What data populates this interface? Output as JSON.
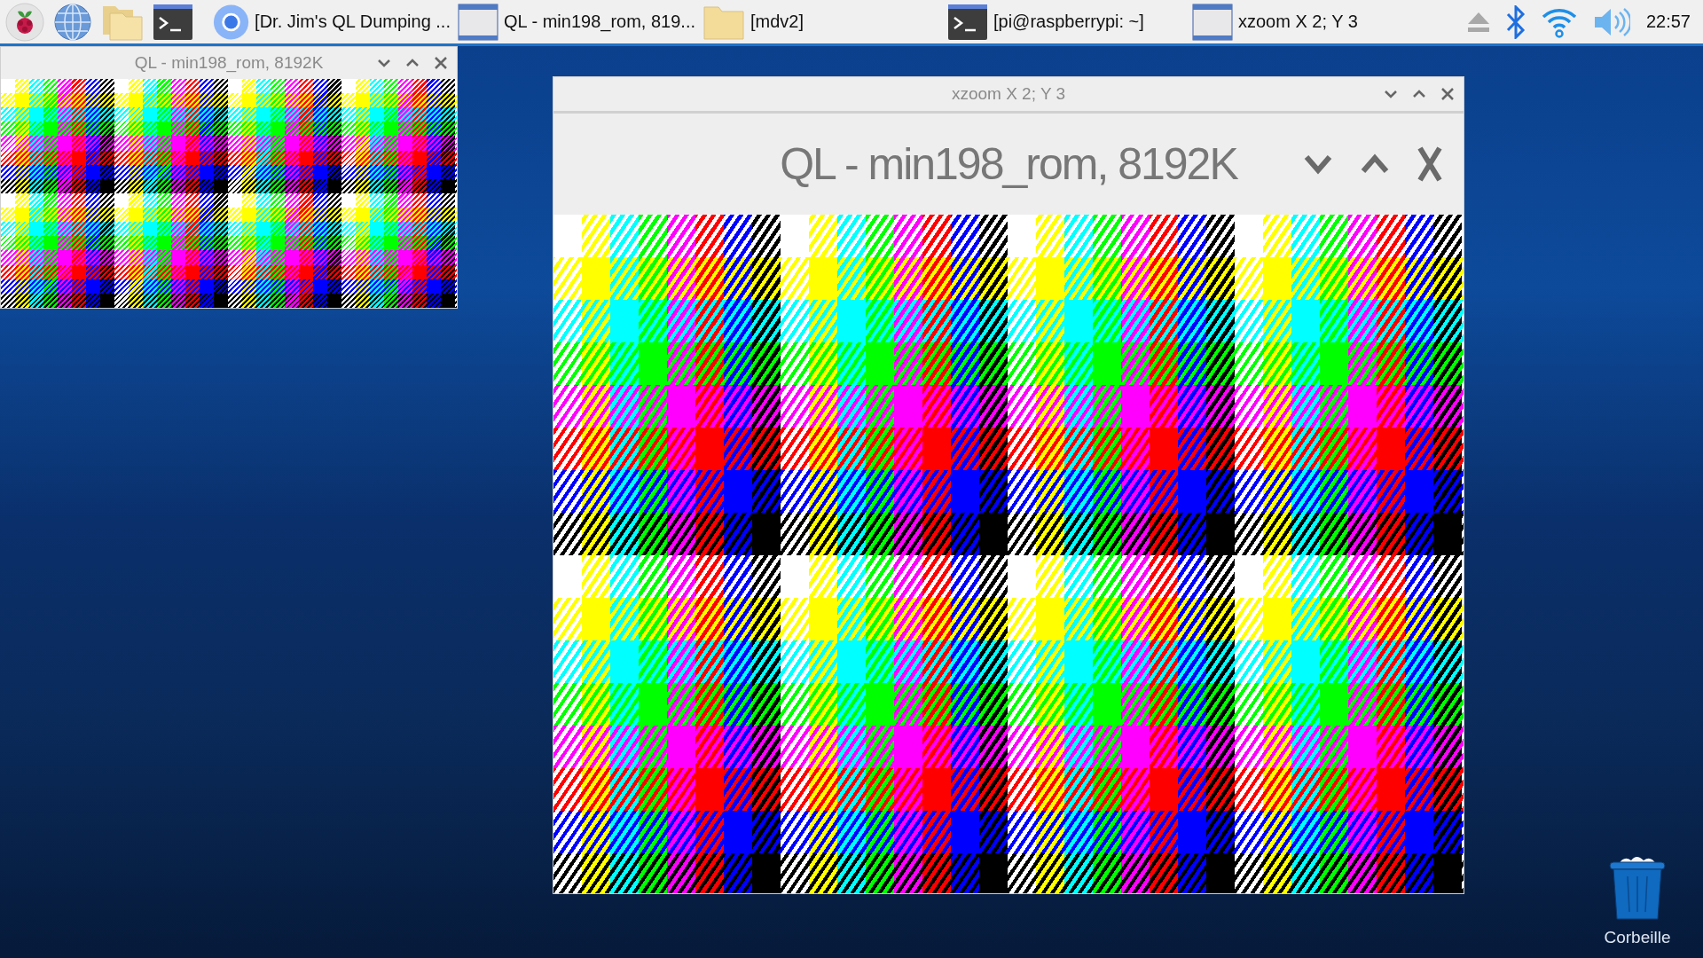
{
  "taskbar": {
    "launchers": [
      {
        "kind": "menu"
      },
      {
        "kind": "browser"
      },
      {
        "kind": "files"
      },
      {
        "kind": "terminal"
      }
    ],
    "tasks": [
      {
        "kind": "chromium",
        "title": "[Dr. Jim's QL Dumping ..."
      },
      {
        "kind": "window",
        "title": "QL - min198_rom, 819..."
      },
      {
        "kind": "folder",
        "title": "[mdv2]"
      },
      {
        "kind": "terminal",
        "title": "[pi@raspberrypi: ~]"
      },
      {
        "kind": "window",
        "title": "xzoom X 2; Y 3"
      }
    ],
    "clock": "22:57"
  },
  "windows": [
    {
      "kind": "emulator",
      "title": "QL - min198_rom, 8192K"
    },
    {
      "kind": "zoom",
      "title": "xzoom X 2; Y 3",
      "zoomed_title": "QL - min198_rom, 8192K"
    }
  ],
  "desktop_icons": [
    {
      "label": "Corbeille"
    }
  ]
}
